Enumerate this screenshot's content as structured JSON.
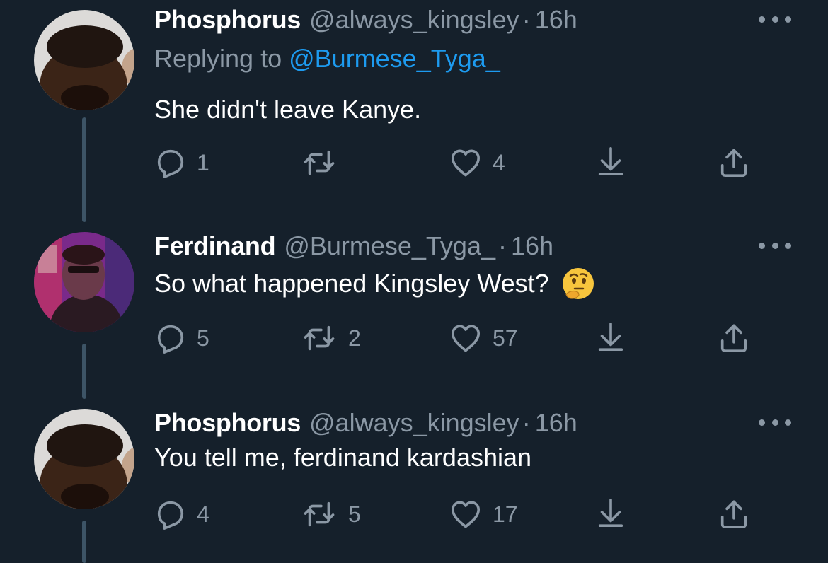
{
  "tweets": [
    {
      "name": "Phosphorus",
      "handle": "@always_kingsley",
      "separator": "·",
      "time": "16h",
      "replying_prefix": "Replying to ",
      "replying_to": "@Burmese_Tyga_",
      "text": "She didn't leave Kanye.",
      "reply_count": "1",
      "retweet_count": "",
      "like_count": "4"
    },
    {
      "name": "Ferdinand",
      "handle": "@Burmese_Tyga_",
      "separator": "·",
      "time": "16h",
      "text": "So what happened Kingsley West?",
      "emoji": "thinking-face",
      "reply_count": "5",
      "retweet_count": "2",
      "like_count": "57"
    },
    {
      "name": "Phosphorus",
      "handle": "@always_kingsley",
      "separator": "·",
      "time": "16h",
      "text": "You tell me, ferdinand kardashian",
      "reply_count": "4",
      "retweet_count": "5",
      "like_count": "17"
    }
  ],
  "icons": {
    "reply": "reply-icon",
    "retweet": "retweet-icon",
    "like": "heart-icon",
    "download": "download-icon",
    "share": "share-icon",
    "more": "more-options-icon"
  },
  "colors": {
    "background": "#15202b",
    "text": "#ffffff",
    "secondary": "#8b98a5",
    "link": "#1d9bf0",
    "thread_line": "#3d5466"
  }
}
